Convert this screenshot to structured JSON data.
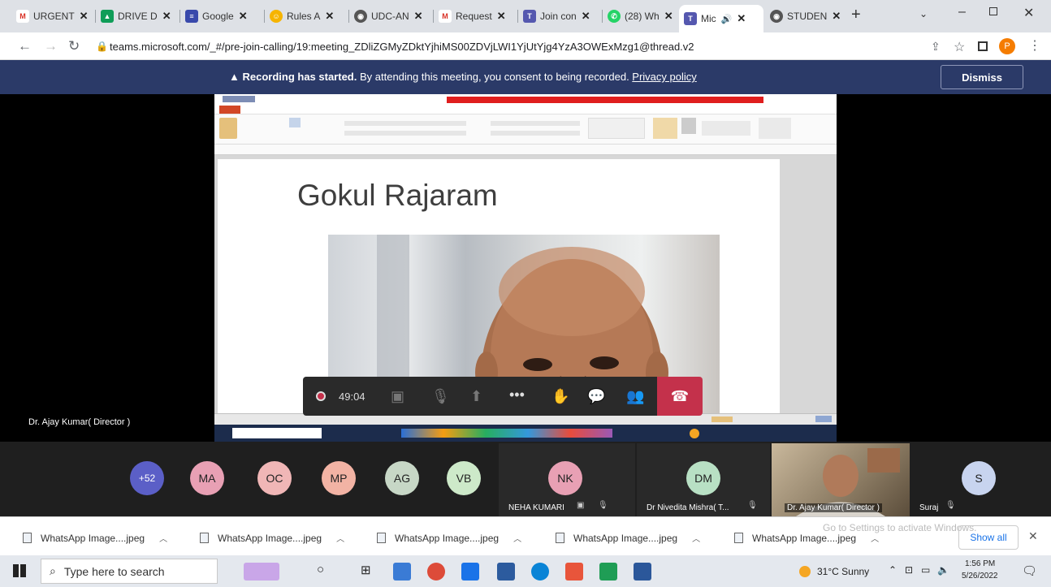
{
  "browser": {
    "tabs": [
      {
        "label": "URGENT",
        "icon": "gmail-icon",
        "color": "#d93025"
      },
      {
        "label": "DRIVE D",
        "icon": "drive-icon",
        "color": "#0f9d58"
      },
      {
        "label": "Google",
        "icon": "forms-icon",
        "color": "#3949ab"
      },
      {
        "label": "Rules A",
        "icon": "rules-icon",
        "color": "#f6b400"
      },
      {
        "label": "UDC-AN",
        "icon": "udc-icon",
        "color": "#555555"
      },
      {
        "label": "Request",
        "icon": "gmail-icon",
        "color": "#d93025"
      },
      {
        "label": "Join con",
        "icon": "teams-icon",
        "color": "#5558af"
      },
      {
        "label": "(28) Wh",
        "icon": "whatsapp-icon",
        "color": "#25d366"
      },
      {
        "label": "Mic",
        "icon": "teams-icon",
        "color": "#5558af"
      },
      {
        "label": "STUDEN",
        "icon": "globe-icon",
        "color": "#555555"
      }
    ],
    "url": "teams.microsoft.com/_#/pre-join-calling/19:meeting_ZDliZGMyZDktYjhiMS00ZDVjLWI1YjUtYjg4YzA3OWExMzg1@thread.v2",
    "profile_initial": "P"
  },
  "banner": {
    "bold": "Recording has started.",
    "text": " By attending this meeting, you consent to being recorded. ",
    "link": "Privacy policy",
    "dismiss": "Dismiss"
  },
  "slide": {
    "title": "Gokul Rajaram"
  },
  "controls": {
    "timer": "49:04"
  },
  "presenter_name": "Dr. Ajay Kumar( Director )",
  "participants": {
    "overflow": "+52",
    "avatars": [
      {
        "initials": "MA",
        "color": "#e8a0b4"
      },
      {
        "initials": "OC",
        "color": "#f0b6b6"
      },
      {
        "initials": "MP",
        "color": "#f2b3a4"
      },
      {
        "initials": "AG",
        "color": "#c7d7c6"
      },
      {
        "initials": "VB",
        "color": "#cde9c9"
      }
    ],
    "tiles": [
      {
        "initials": "NK",
        "name": "NEHA KUMARI",
        "color": "#e8a0b4"
      },
      {
        "initials": "DM",
        "name": "Dr Nivedita Mishra( T...",
        "color": "#b8e0c4"
      },
      {
        "name": "Dr. Ajay Kumar( Director )"
      },
      {
        "initials": "S",
        "name": "Suraj",
        "color": "#c8d4ef"
      }
    ],
    "overflow_color": "#5b5fc7"
  },
  "downloads": {
    "items": [
      "WhatsApp Image....jpeg",
      "WhatsApp Image....jpeg",
      "WhatsApp Image....jpeg",
      "WhatsApp Image....jpeg",
      "WhatsApp Image....jpeg"
    ],
    "show_all": "Show all",
    "watermark": "Go to Settings to activate Windows."
  },
  "taskbar": {
    "search_placeholder": "Type here to search",
    "weather": "31°C  Sunny",
    "time": "1:56 PM",
    "date": "5/26/2022"
  }
}
